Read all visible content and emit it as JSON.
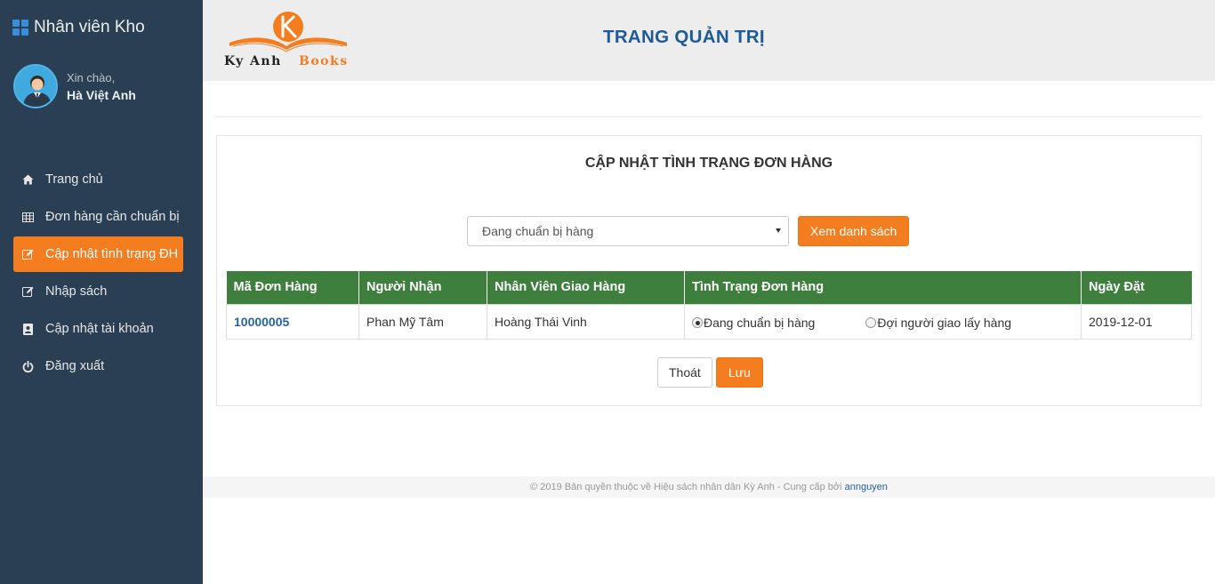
{
  "sidebar": {
    "brand": "Nhân viên Kho",
    "greeting": "Xin chào,",
    "username": "Hà Việt Anh",
    "items": [
      {
        "label": "Trang chủ",
        "icon": "home-icon"
      },
      {
        "label": "Đơn hàng cần chuẩn bị",
        "icon": "table-icon"
      },
      {
        "label": "Cập nhật tình trạng ĐH",
        "icon": "edit-icon"
      },
      {
        "label": "Nhập sách",
        "icon": "edit-icon"
      },
      {
        "label": "Cập nhật tài khoản",
        "icon": "account-icon"
      },
      {
        "label": "Đăng xuất",
        "icon": "power-icon"
      }
    ],
    "active_index": 2
  },
  "header": {
    "logo_text_1": "Ky Anh",
    "logo_text_2": "Books",
    "title": "TRANG QUẢN TRỊ"
  },
  "panel": {
    "title": "CẬP NHẬT TÌNH TRẠNG ĐƠN HÀNG",
    "filter_value": "Đang chuẩn bị hàng",
    "view_button": "Xem danh sách"
  },
  "table": {
    "headers": [
      "Mã Đơn Hàng",
      "Người Nhận",
      "Nhân Viên Giao Hàng",
      "Tình Trạng Đơn Hàng",
      "Ngày Đặt"
    ],
    "rows": [
      {
        "order_id": "10000005",
        "recipient": "Phan Mỹ Tâm",
        "shipper": "Hoàng Thái Vinh",
        "status_options": [
          "Đang chuẩn bị hàng",
          "Đợi người giao lấy hàng"
        ],
        "status_selected": 0,
        "date": "2019-12-01"
      }
    ]
  },
  "actions": {
    "exit": "Thoát",
    "save": "Lưu"
  },
  "footer": {
    "text": "© 2019 Bản quyền thuộc về Hiệu sách nhân dân Kỳ Anh - Cung cấp bởi",
    "link": "annguyen"
  },
  "colors": {
    "sidebar_bg": "#2a3f54",
    "accent_orange": "#f47d20",
    "table_header": "#3f7f3e",
    "title_blue": "#1e5a96"
  }
}
